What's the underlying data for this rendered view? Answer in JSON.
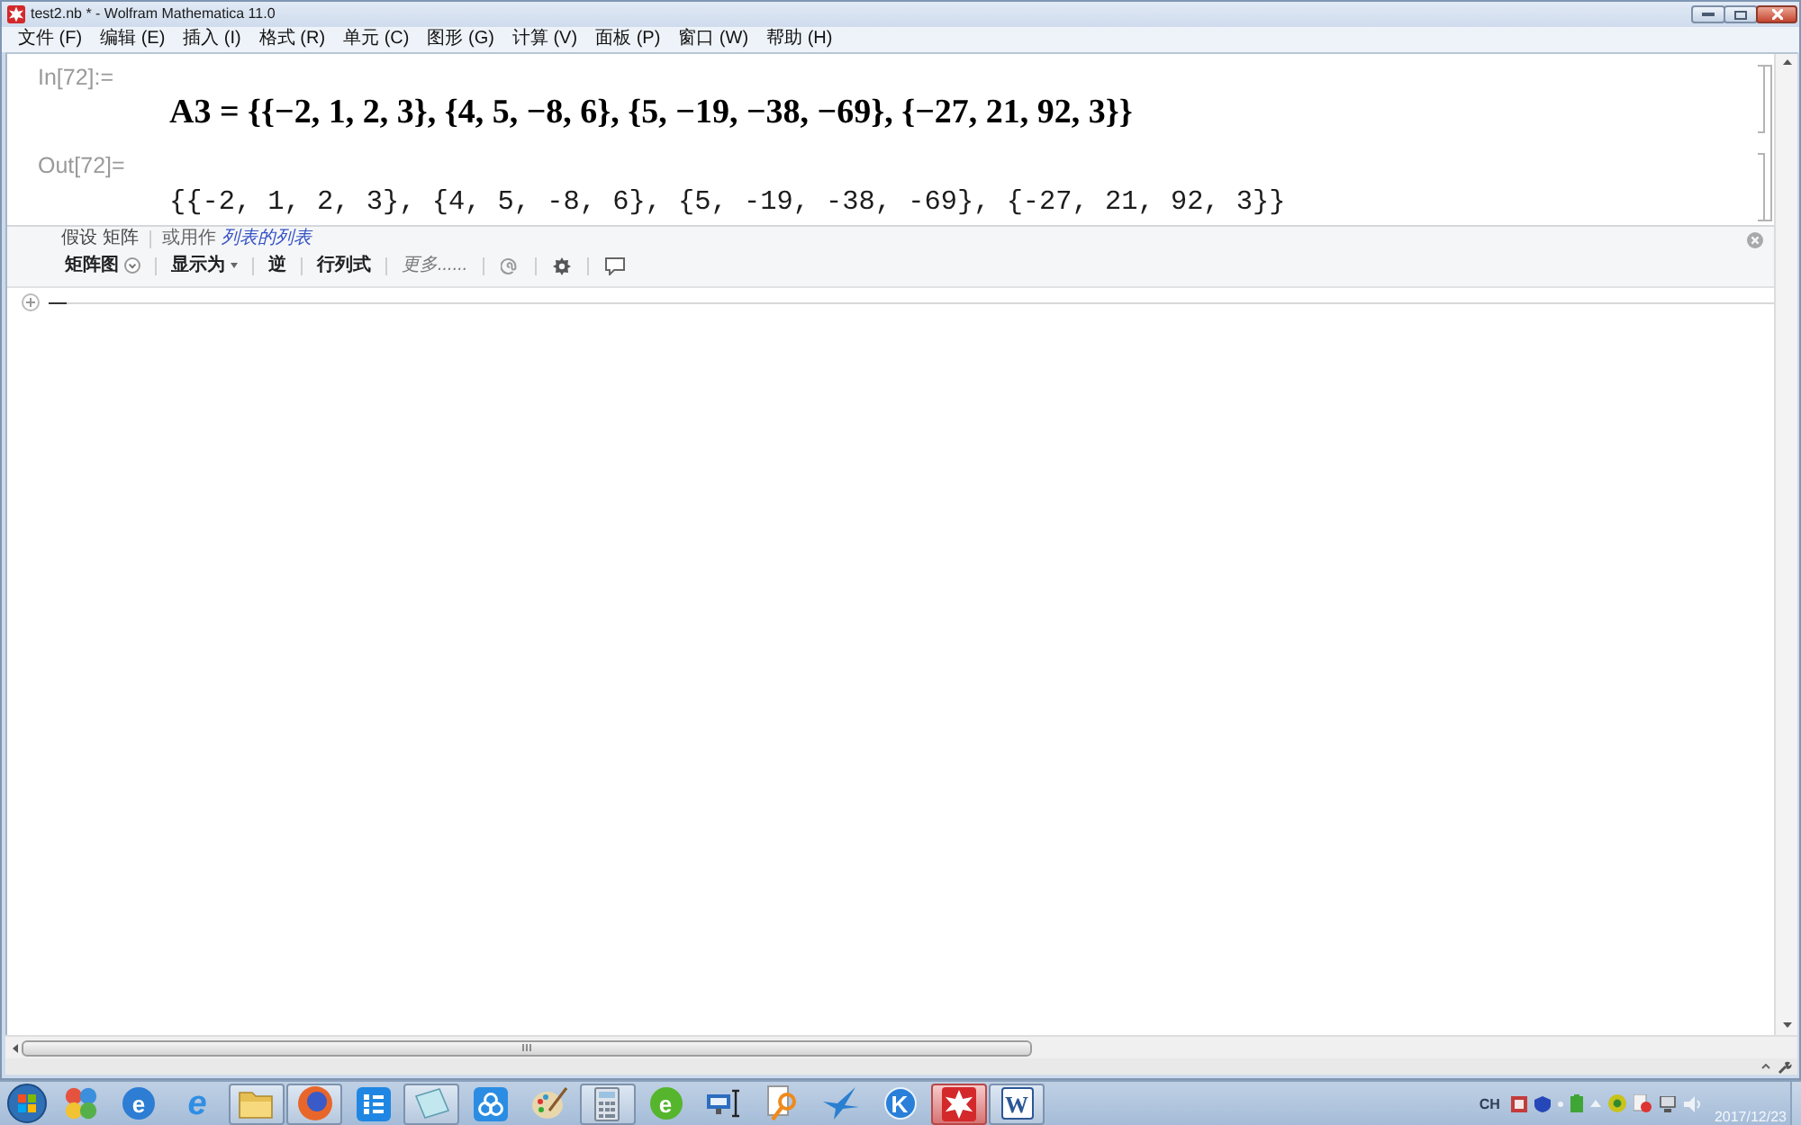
{
  "window": {
    "title": "test2.nb * - Wolfram Mathematica 11.0"
  },
  "menu": [
    "文件 (F)",
    "编辑 (E)",
    "插入 (I)",
    "格式 (R)",
    "单元 (C)",
    "图形 (G)",
    "计算 (V)",
    "面板 (P)",
    "窗口 (W)",
    "帮助 (H)"
  ],
  "notebook": {
    "cells": [
      {
        "kind": "input",
        "label": "In[72]:=",
        "content": "A3 = {{−2, 1, 2, 3}, {4, 5, −8, 6}, {5, −19, −38, −69}, {−27, 21, 92, 3}}"
      },
      {
        "kind": "output",
        "label": "Out[72]=",
        "content": "{{-2, 1, 2, 3}, {4, 5, -8, 6}, {5, -19, -38, -69}, {-27, 21, 92, 3}}"
      }
    ],
    "suggestions_bar": {
      "assumption": "假设 矩阵",
      "alternative_prompt": "或用作",
      "alternative_link": "列表的列表",
      "actions": [
        {
          "kind": "dropdown",
          "label": "矩阵图"
        },
        {
          "kind": "menu",
          "label": "显示为"
        },
        {
          "kind": "plain",
          "label": "逆"
        },
        {
          "kind": "plain",
          "label": "行列式"
        },
        {
          "kind": "more",
          "label": "更多......"
        }
      ]
    }
  },
  "taskbar": {
    "apps": [
      {
        "kind": "spheres",
        "running": false,
        "active": false
      },
      {
        "kind": "ebadge",
        "glyph": "e",
        "running": false,
        "active": false
      },
      {
        "kind": "eswoosh",
        "glyph": "e",
        "running": false,
        "active": false
      },
      {
        "kind": "folder",
        "running": true,
        "active": false
      },
      {
        "kind": "ringglobe",
        "running": true,
        "active": false
      },
      {
        "kind": "list",
        "running": false,
        "active": false
      },
      {
        "kind": "notepad",
        "running": true,
        "active": false
      },
      {
        "kind": "cloud",
        "running": false,
        "active": false
      },
      {
        "kind": "palette",
        "running": false,
        "active": false
      },
      {
        "kind": "calculator",
        "running": true,
        "active": false
      },
      {
        "kind": "greene",
        "glyph": "e",
        "running": false,
        "active": false
      },
      {
        "kind": "monitor",
        "running": false,
        "active": false
      },
      {
        "kind": "magnifier",
        "running": false,
        "active": false
      },
      {
        "kind": "bird",
        "running": false,
        "active": false
      },
      {
        "kind": "kbadge",
        "glyph": "K",
        "running": false,
        "active": false
      },
      {
        "kind": "star",
        "running": true,
        "active": true
      },
      {
        "kind": "worddoc",
        "glyph": "W",
        "running": true,
        "active": false
      }
    ],
    "tray": {
      "language": "CH",
      "date": "2017/12/23"
    }
  }
}
